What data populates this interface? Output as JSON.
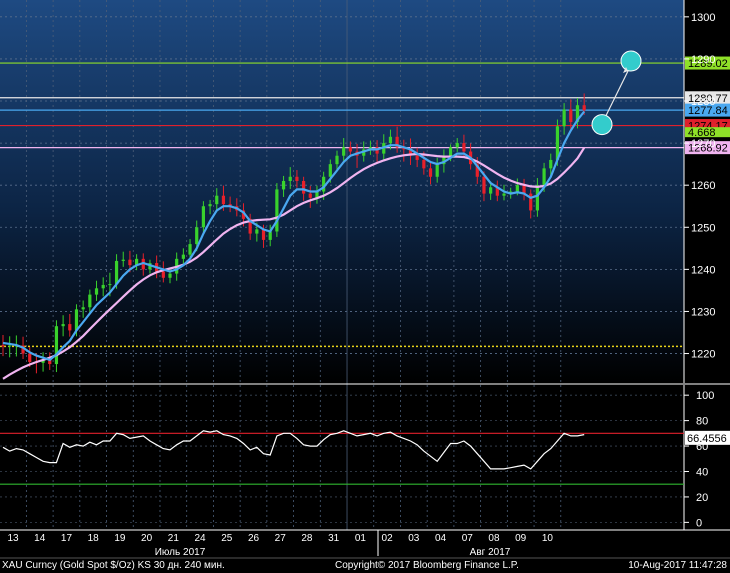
{
  "chart_data": [
    {
      "type": "candlestick",
      "ylim": [
        1213,
        1304
      ],
      "yticks": [
        1220,
        1230,
        1240,
        1250,
        1260,
        1270,
        1280,
        1290,
        1300
      ],
      "x_labels": [
        "13",
        "14",
        "17",
        "18",
        "19",
        "20",
        "21",
        "24",
        "25",
        "26",
        "27",
        "28",
        "31",
        "01",
        "02",
        "03",
        "04",
        "07",
        "08",
        "09",
        "10"
      ],
      "month_labels": [
        "Июль 2017",
        "Авг 2017"
      ],
      "ohlc": [
        [
          1222,
          1224.4,
          1219.4,
          1221.7
        ],
        [
          1221.7,
          1224.1,
          1219.1,
          1221.9
        ],
        [
          1221.9,
          1224.3,
          1219.3,
          1221.9
        ],
        [
          1221.9,
          1224.0,
          1218.7,
          1220.0
        ],
        [
          1220.0,
          1221.5,
          1216.8,
          1218.0
        ],
        [
          1218.0,
          1220.0,
          1215.3,
          1217.8
        ],
        [
          1217.8,
          1220.3,
          1215.7,
          1218.5
        ],
        [
          1218.5,
          1220.3,
          1216.1,
          1217.5
        ],
        [
          1217.5,
          1227.9,
          1215.6,
          1226.5
        ],
        [
          1226.5,
          1229.1,
          1224.1,
          1227.0
        ],
        [
          1227.0,
          1229.4,
          1224.0,
          1225.5
        ],
        [
          1225.5,
          1231.7,
          1224.1,
          1230.5
        ],
        [
          1230.5,
          1232.6,
          1228.5,
          1231.0
        ],
        [
          1231.0,
          1235.2,
          1229.8,
          1234.0
        ],
        [
          1234.0,
          1237.3,
          1232.5,
          1235.5
        ],
        [
          1235.5,
          1238.1,
          1233.6,
          1236.3
        ],
        [
          1236.3,
          1239.2,
          1233.6,
          1236.5
        ],
        [
          1236.5,
          1243.6,
          1235.4,
          1242.0
        ],
        [
          1242.0,
          1244.2,
          1240.6,
          1242.3
        ],
        [
          1242.3,
          1244.4,
          1239.3,
          1241.0
        ],
        [
          1241.0,
          1243.6,
          1239.8,
          1242.5
        ],
        [
          1242.5,
          1243.8,
          1238.5,
          1240.0
        ],
        [
          1240.0,
          1242.3,
          1239.0,
          1241.5
        ],
        [
          1241.5,
          1243.3,
          1237.9,
          1239.5
        ],
        [
          1239.5,
          1241.9,
          1236.9,
          1238.0
        ],
        [
          1238.0,
          1240.0,
          1236.7,
          1239.0
        ],
        [
          1239.0,
          1244.0,
          1237.3,
          1242.5
        ],
        [
          1242.5,
          1245.0,
          1241.4,
          1243.5
        ],
        [
          1243.5,
          1247.2,
          1242.4,
          1246.0
        ],
        [
          1246.0,
          1251.6,
          1244.3,
          1250.0
        ],
        [
          1250.0,
          1256.2,
          1248.8,
          1255.0
        ],
        [
          1255.0,
          1256.5,
          1253.1,
          1255.5
        ],
        [
          1255.5,
          1259.3,
          1253.6,
          1257.5
        ],
        [
          1257.5,
          1259.9,
          1253.9,
          1255.5
        ],
        [
          1255.5,
          1257.3,
          1253.6,
          1255.0
        ],
        [
          1255.0,
          1256.9,
          1252.6,
          1254.0
        ],
        [
          1254.0,
          1255.7,
          1250.2,
          1252.0
        ],
        [
          1252.0,
          1253.2,
          1247.0,
          1248.5
        ],
        [
          1248.5,
          1251.1,
          1246.6,
          1249.5
        ],
        [
          1249.5,
          1250.6,
          1245.1,
          1247.0
        ],
        [
          1247.0,
          1250.6,
          1245.5,
          1249.0
        ],
        [
          1249.0,
          1260.5,
          1247.7,
          1259.0
        ],
        [
          1259.0,
          1262.2,
          1257.2,
          1261.0
        ],
        [
          1261.0,
          1264.3,
          1259.1,
          1262.0
        ],
        [
          1262.0,
          1263.6,
          1259.4,
          1261.0
        ],
        [
          1261.0,
          1262.0,
          1256.3,
          1258.0
        ],
        [
          1258.0,
          1259.8,
          1254.6,
          1257.0
        ],
        [
          1257.0,
          1259.9,
          1255.6,
          1258.5
        ],
        [
          1258.5,
          1263.2,
          1256.5,
          1262.0
        ],
        [
          1262.0,
          1266.1,
          1260.6,
          1265.0
        ],
        [
          1265.0,
          1268.2,
          1263.2,
          1267.0
        ],
        [
          1267.0,
          1271.2,
          1265.7,
          1269.0
        ],
        [
          1269.0,
          1270.4,
          1266.8,
          1268.0
        ],
        [
          1268.0,
          1269.8,
          1264.1,
          1267.0
        ],
        [
          1267.0,
          1270.4,
          1265.6,
          1268.5
        ],
        [
          1268.5,
          1270.6,
          1267.2,
          1269.0
        ],
        [
          1269.0,
          1270.7,
          1265.5,
          1267.5
        ],
        [
          1267.5,
          1272.1,
          1265.9,
          1270.0
        ],
        [
          1270.0,
          1273.2,
          1268.5,
          1271.5
        ],
        [
          1271.5,
          1273.9,
          1267.7,
          1269.0
        ],
        [
          1269.0,
          1270.8,
          1265.6,
          1268.5
        ],
        [
          1268.5,
          1271.1,
          1264.8,
          1267.0
        ],
        [
          1267.0,
          1268.9,
          1264.3,
          1266.0
        ],
        [
          1266.0,
          1268.0,
          1262.5,
          1264.0
        ],
        [
          1264.0,
          1265.8,
          1260.2,
          1262.0
        ],
        [
          1262.0,
          1266.5,
          1260.6,
          1265.0
        ],
        [
          1265.0,
          1268.5,
          1263.0,
          1267.0
        ],
        [
          1267.0,
          1269.7,
          1265.7,
          1269.0
        ],
        [
          1269.0,
          1271.2,
          1267.9,
          1270.0
        ],
        [
          1270.0,
          1272.0,
          1266.5,
          1268.0
        ],
        [
          1268.0,
          1269.9,
          1263.7,
          1265.0
        ],
        [
          1265.0,
          1266.7,
          1260.3,
          1262.0
        ],
        [
          1262.0,
          1263.3,
          1256.2,
          1258.0
        ],
        [
          1258.0,
          1260.9,
          1256.5,
          1259.5
        ],
        [
          1259.5,
          1261.1,
          1256.2,
          1257.5
        ],
        [
          1257.5,
          1260.1,
          1256.4,
          1258.0
        ],
        [
          1258.0,
          1259.4,
          1256.8,
          1258.5
        ],
        [
          1258.5,
          1261.6,
          1257.6,
          1260.0
        ],
        [
          1260.0,
          1261.5,
          1256.4,
          1258.0
        ],
        [
          1258.0,
          1259.0,
          1252.1,
          1254.0
        ],
        [
          1254.0,
          1261.7,
          1252.5,
          1260.0
        ],
        [
          1260.0,
          1265.3,
          1258.4,
          1264.0
        ],
        [
          1264.0,
          1267.5,
          1261.8,
          1266.0
        ],
        [
          1266.0,
          1275.6,
          1264.6,
          1274.0
        ],
        [
          1274.0,
          1279.5,
          1272.0,
          1278.0
        ],
        [
          1278.0,
          1280.4,
          1273.0,
          1275.0
        ],
        [
          1275.0,
          1280.7,
          1273.5,
          1279.0
        ],
        [
          1279.0,
          1281.8,
          1276.7,
          1277.8
        ]
      ],
      "ma_fast": [
        1222.5,
        1222.3,
        1222.0,
        1221.4,
        1220.3,
        1219.5,
        1219.0,
        1218.5,
        1219.8,
        1221.5,
        1223.0,
        1225.5,
        1227.5,
        1229.5,
        1231.5,
        1233.0,
        1234.5,
        1236.5,
        1238.5,
        1240.0,
        1241.0,
        1241.5,
        1241.0,
        1240.5,
        1240.0,
        1239.5,
        1240.0,
        1241.0,
        1242.5,
        1245.0,
        1248.5,
        1251.5,
        1254.0,
        1255.0,
        1255.0,
        1254.5,
        1253.5,
        1251.5,
        1250.5,
        1249.5,
        1249.0,
        1251.5,
        1254.5,
        1257.5,
        1259.0,
        1259.0,
        1258.5,
        1258.5,
        1259.5,
        1261.5,
        1263.5,
        1265.5,
        1267.0,
        1267.5,
        1268.0,
        1268.5,
        1268.5,
        1269.0,
        1269.5,
        1269.5,
        1269.0,
        1268.5,
        1267.5,
        1266.5,
        1265.5,
        1265.0,
        1265.5,
        1266.5,
        1267.5,
        1267.5,
        1266.5,
        1264.5,
        1262.5,
        1260.5,
        1259.5,
        1258.5,
        1258.0,
        1258.3,
        1258.0,
        1257.0,
        1257.5,
        1259.5,
        1262.0,
        1266.0,
        1270.0,
        1273.0,
        1275.5,
        1277.5
      ],
      "ma_slow": [
        1214.0,
        1215.0,
        1215.9,
        1216.7,
        1217.4,
        1218.0,
        1218.5,
        1219.0,
        1219.6,
        1220.5,
        1221.5,
        1222.8,
        1224.2,
        1225.8,
        1227.4,
        1229.0,
        1230.5,
        1232.0,
        1233.5,
        1235.0,
        1236.4,
        1237.6,
        1238.6,
        1239.3,
        1239.8,
        1240.2,
        1240.6,
        1241.1,
        1241.8,
        1242.8,
        1244.1,
        1245.6,
        1247.1,
        1248.5,
        1249.6,
        1250.5,
        1251.1,
        1251.5,
        1251.7,
        1251.8,
        1251.9,
        1252.3,
        1253.0,
        1254.0,
        1255.0,
        1255.8,
        1256.4,
        1256.9,
        1257.5,
        1258.3,
        1259.3,
        1260.5,
        1261.7,
        1262.8,
        1263.8,
        1264.6,
        1265.3,
        1265.9,
        1266.4,
        1266.8,
        1267.1,
        1267.3,
        1267.4,
        1267.3,
        1267.1,
        1266.9,
        1266.8,
        1266.8,
        1266.8,
        1266.7,
        1266.3,
        1265.6,
        1264.7,
        1263.7,
        1262.7,
        1261.8,
        1261.1,
        1260.5,
        1260.1,
        1259.7,
        1259.6,
        1259.8,
        1260.4,
        1261.5,
        1263.0,
        1264.6,
        1266.4,
        1268.9
      ]
    },
    {
      "type": "line",
      "ylim": [
        -6,
        108
      ],
      "yticks": [
        0,
        20,
        40,
        60,
        80,
        100
      ],
      "values": [
        59,
        56,
        58,
        57,
        54,
        51,
        48,
        47,
        47,
        62,
        59,
        61,
        60,
        63,
        61,
        64,
        64,
        70,
        69,
        66,
        67,
        68,
        64,
        61,
        58,
        57,
        61,
        64,
        64,
        68,
        72,
        71,
        72,
        69,
        68,
        66,
        62,
        57,
        59,
        54,
        53,
        68,
        70,
        70,
        66,
        61,
        60,
        60,
        65,
        69,
        70,
        72,
        70,
        68,
        69,
        70,
        68,
        70,
        71,
        68,
        66,
        64,
        61,
        56,
        52,
        48,
        55,
        62,
        62,
        64,
        60,
        54,
        48,
        42,
        42,
        42,
        43,
        44,
        45,
        42,
        48,
        54,
        58,
        64,
        70,
        68,
        68,
        69
      ],
      "last_value": 66.4556
    }
  ],
  "levels": [
    {
      "value": 1289.02,
      "label": "1289.02",
      "color": "#8fe028"
    },
    {
      "value": 1280.77,
      "label": "1280.77",
      "color": "#e8e8e8"
    },
    {
      "value": 1277.84,
      "label": "1277.84",
      "color": "#4aa8f0"
    },
    {
      "value": 1274.17,
      "label": "1274.17",
      "color": "#e0202c"
    },
    {
      "value": 1268.92,
      "label": "1268.92",
      "color": "#f0b4f0"
    }
  ],
  "level_green_small": "4.668",
  "support_level": 1221.7,
  "rsi_bands": [
    70,
    30
  ],
  "bottom_bar": {
    "left": "XAU Curncy (Gold Spot  $/Oz) KS 30 дн. 240 мин.",
    "center": "Copyright© 2017 Bloomberg Finance L.P.",
    "right": "10-Aug-2017 11:47:28"
  },
  "colors": {
    "up": "#39d22c",
    "down": "#e8202a",
    "fast": "#4aa8f0",
    "slow": "#f0b4f0",
    "accent": "#33cccc"
  }
}
